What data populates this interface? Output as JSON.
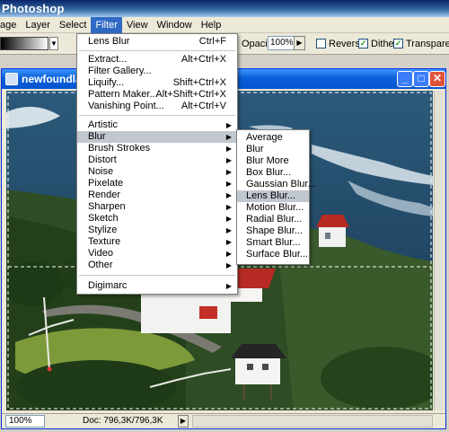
{
  "app": {
    "title": "Photoshop"
  },
  "menubar": [
    "age",
    "Layer",
    "Select",
    "Filter",
    "View",
    "Window",
    "Help"
  ],
  "options": {
    "opacity_label": "Opacity:",
    "opacity_value": "100%",
    "reverse_label": "Reverse",
    "dither_label": "Dither",
    "transparency_label": "Transparency",
    "reverse_checked": false,
    "dither_checked": true,
    "transparency_checked": true
  },
  "document": {
    "title": "newfoundlan",
    "zoom": "100%",
    "doc_info": "Doc: 796,3K/796,3K"
  },
  "filter_menu": {
    "last_filter": {
      "label": "Lens Blur",
      "shortcut": "Ctrl+F"
    },
    "group1": [
      {
        "label": "Extract...",
        "shortcut": "Alt+Ctrl+X"
      },
      {
        "label": "Filter Gallery...",
        "shortcut": ""
      },
      {
        "label": "Liquify...",
        "shortcut": "Shift+Ctrl+X"
      },
      {
        "label": "Pattern Maker...",
        "shortcut": "Alt+Shift+Ctrl+X"
      },
      {
        "label": "Vanishing Point...",
        "shortcut": "Alt+Ctrl+V"
      }
    ],
    "group2": [
      "Artistic",
      "Blur",
      "Brush Strokes",
      "Distort",
      "Noise",
      "Pixelate",
      "Render",
      "Sharpen",
      "Sketch",
      "Stylize",
      "Texture",
      "Video",
      "Other"
    ],
    "group3": [
      "Digimarc"
    ],
    "highlighted": "Blur"
  },
  "blur_menu": {
    "items": [
      "Average",
      "Blur",
      "Blur More",
      "Box Blur...",
      "Gaussian Blur...",
      "Lens Blur...",
      "Motion Blur...",
      "Radial Blur...",
      "Shape Blur...",
      "Smart Blur...",
      "Surface Blur..."
    ],
    "highlighted": "Lens Blur..."
  },
  "colors": {
    "menu_highlight": "#c1c7cf",
    "title_blue": "#0a5fd8",
    "close_red": "#e0533b"
  }
}
